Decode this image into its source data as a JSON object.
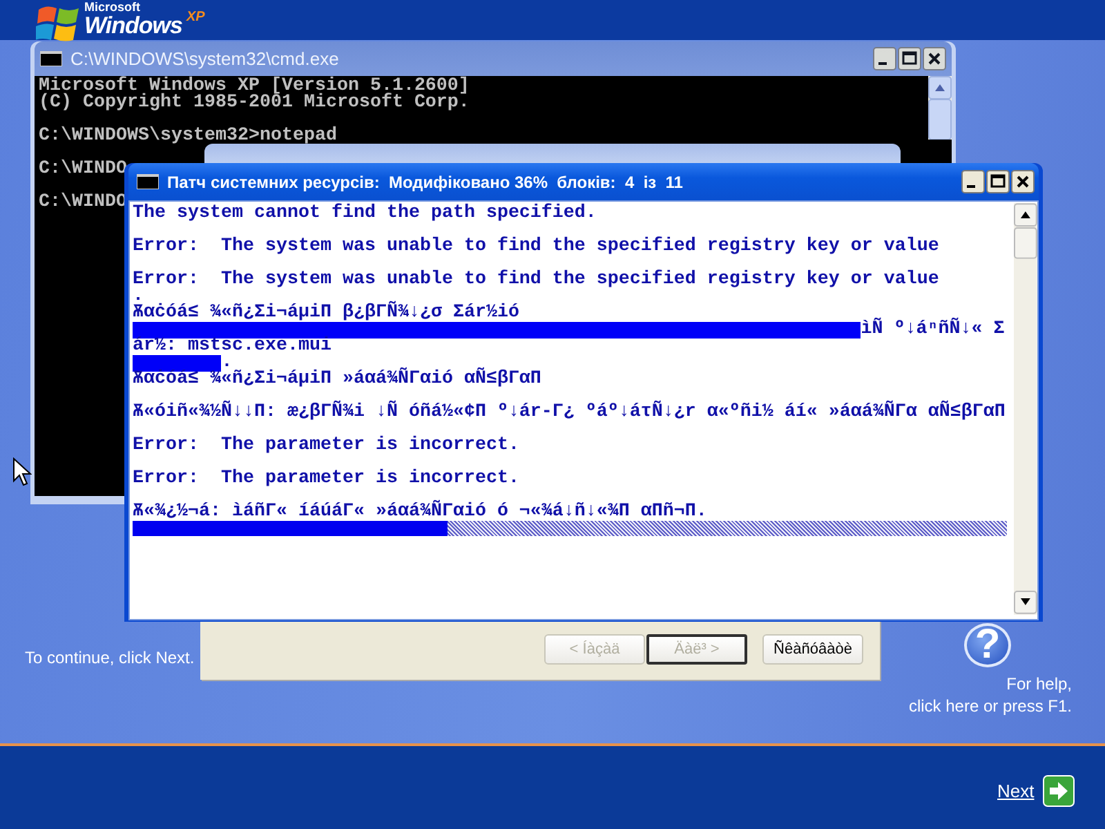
{
  "logo": {
    "brand": "Microsoft",
    "name": "Windows",
    "edition": "XP"
  },
  "cmd_window": {
    "title": "C:\\WINDOWS\\system32\\cmd.exe",
    "active": false,
    "lines": [
      {
        "kind": "text",
        "text": "Microsoft Windows XP [Version 5.1.2600]"
      },
      {
        "kind": "text",
        "text": "(C) Copyright 1985-2001 Microsoft Corp."
      },
      {
        "kind": "blank"
      },
      {
        "kind": "text",
        "text": "C:\\WINDOWS\\system32>notepad"
      },
      {
        "kind": "blank"
      },
      {
        "kind": "text",
        "text": "C:\\WINDO"
      },
      {
        "kind": "blank"
      },
      {
        "kind": "text",
        "text": "C:\\WINDO"
      }
    ]
  },
  "background_window": {
    "active": false
  },
  "wizard": {
    "message": "To continue, click Next.",
    "buttons": [
      {
        "label": "< Íàçàä",
        "disabled": true,
        "default": false
      },
      {
        "label": "Äàë³ >",
        "disabled": true,
        "default": true
      },
      {
        "label": "Ñêàñóâàòè",
        "disabled": false,
        "default": false
      }
    ]
  },
  "help": {
    "glyph": "?",
    "lines": [
      "For help,",
      "click here or press F1."
    ]
  },
  "patch_window": {
    "title": "Патч системних ресурсів:  Модифіковано 36%  блоків:  4  із  11",
    "active": true,
    "lines": [
      {
        "kind": "text",
        "text": "The system cannot find the path specified."
      },
      {
        "kind": "blank"
      },
      {
        "kind": "text",
        "text": "Error:  The system was unable to find the specified registry key or value"
      },
      {
        "kind": "blank"
      },
      {
        "kind": "text",
        "text": "Error:  The system was unable to find the specified registry key or value"
      },
      {
        "kind": "text",
        "text": "."
      },
      {
        "kind": "text",
        "text": "Ѫαċóá≤ ¾«ñ¿Σi¬áµiΠ β¿βΓÑ¾↓¿σ Σár½ió"
      },
      {
        "kind": "highlight",
        "level": 0.82,
        "text": "ìÑ º↓áⁿñÑ↓« Σ"
      },
      {
        "kind": "text",
        "text": "ár½: mstsc.exe.mui"
      },
      {
        "kind": "highlight",
        "level": 0.1,
        "text": "."
      },
      {
        "kind": "text",
        "text": "Ѫαċóá≤ ¾«ñ¿Σi¬áµiΠ »áαá¾ÑΓαió αÑ≤βΓαΠ"
      },
      {
        "kind": "blank"
      },
      {
        "kind": "text",
        "text": "Ѫ«óiñ«¾½Ñ↓↓Π: æ¿βΓÑ¾i ↓Ñ óñá½«¢Π º↓ár-Γ¿ ºáº↓áτÑ↓¿r α«ºñi½ áí« »áαá¾ÑΓα αÑ≤βΓαΠ"
      },
      {
        "kind": "blank"
      },
      {
        "kind": "text",
        "text": "Error:  The parameter is incorrect."
      },
      {
        "kind": "blank"
      },
      {
        "kind": "text",
        "text": "Error:  The parameter is incorrect."
      },
      {
        "kind": "blank"
      },
      {
        "kind": "text",
        "text": "Ѫ«¾¿½¬á: ìáñΓ« íáúáΓ« »áαá¾ÑΓαió ó ¬«¾á↓ñ↓«¾Π αΠñ¬Π."
      },
      {
        "kind": "progress",
        "level": 0.36
      }
    ]
  },
  "next_link": {
    "label": "Next"
  }
}
